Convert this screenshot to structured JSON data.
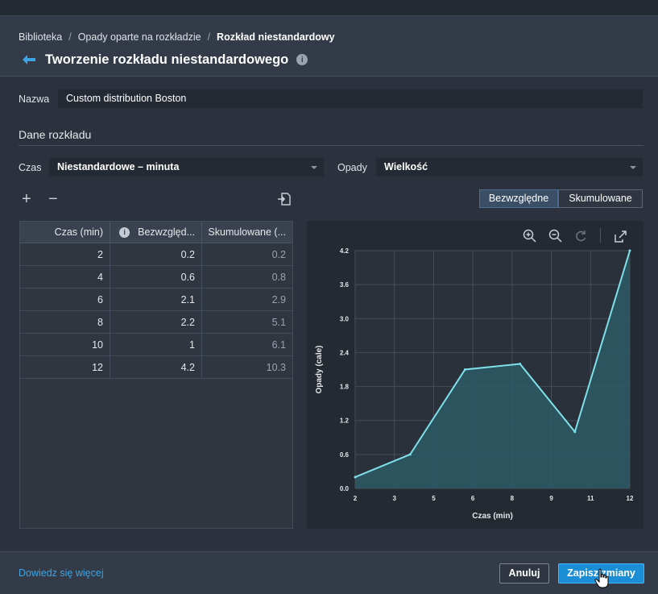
{
  "breadcrumb": {
    "items": [
      "Biblioteka",
      "Opady oparte na rozkładzie"
    ],
    "current": "Rozkład niestandardowy"
  },
  "page": {
    "title": "Tworzenie rozkładu niestandardowego"
  },
  "name_field": {
    "label": "Nazwa",
    "value": "Custom distribution Boston"
  },
  "section": {
    "title": "Dane rozkładu"
  },
  "time_select": {
    "label": "Czas",
    "value": "Niestandardowe – minuta"
  },
  "precip_select": {
    "label": "Opady",
    "value": "Wielkość"
  },
  "toggle": {
    "absolute": "Bezwzględne",
    "cumulative": "Skumulowane",
    "active": "absolute"
  },
  "table": {
    "headers": [
      "Czas (min)",
      "Bezwzględ...",
      "Skumulowane (..."
    ],
    "rows": [
      [
        "2",
        "0.2",
        "0.2"
      ],
      [
        "4",
        "0.6",
        "0.8"
      ],
      [
        "6",
        "2.1",
        "2.9"
      ],
      [
        "8",
        "2.2",
        "5.1"
      ],
      [
        "10",
        "1",
        "6.1"
      ],
      [
        "12",
        "4.2",
        "10.3"
      ]
    ]
  },
  "chart_data": {
    "type": "area",
    "xlabel": "Czas (min)",
    "ylabel": "Opady (cale)",
    "x_ticks": [
      "2",
      "3",
      "5",
      "6",
      "8",
      "9",
      "11",
      "12"
    ],
    "y_ticks": [
      "0.0",
      "0.6",
      "1.2",
      "1.8",
      "2.4",
      "3.0",
      "3.6",
      "4.2"
    ],
    "ylim": [
      0,
      4.2
    ],
    "x": [
      2,
      4,
      6,
      8,
      10,
      12
    ],
    "values": [
      0.2,
      0.6,
      2.1,
      2.2,
      1,
      4.2
    ],
    "grid": true,
    "colors": {
      "line": "#7fe0ea",
      "fill": "#2c5a66"
    }
  },
  "footer": {
    "learn_more": "Dowiedz się więcej",
    "cancel": "Anuluj",
    "save": "Zapisz zmiany"
  },
  "colors": {
    "accent": "#1b8ed6",
    "link": "#3da4e3"
  }
}
